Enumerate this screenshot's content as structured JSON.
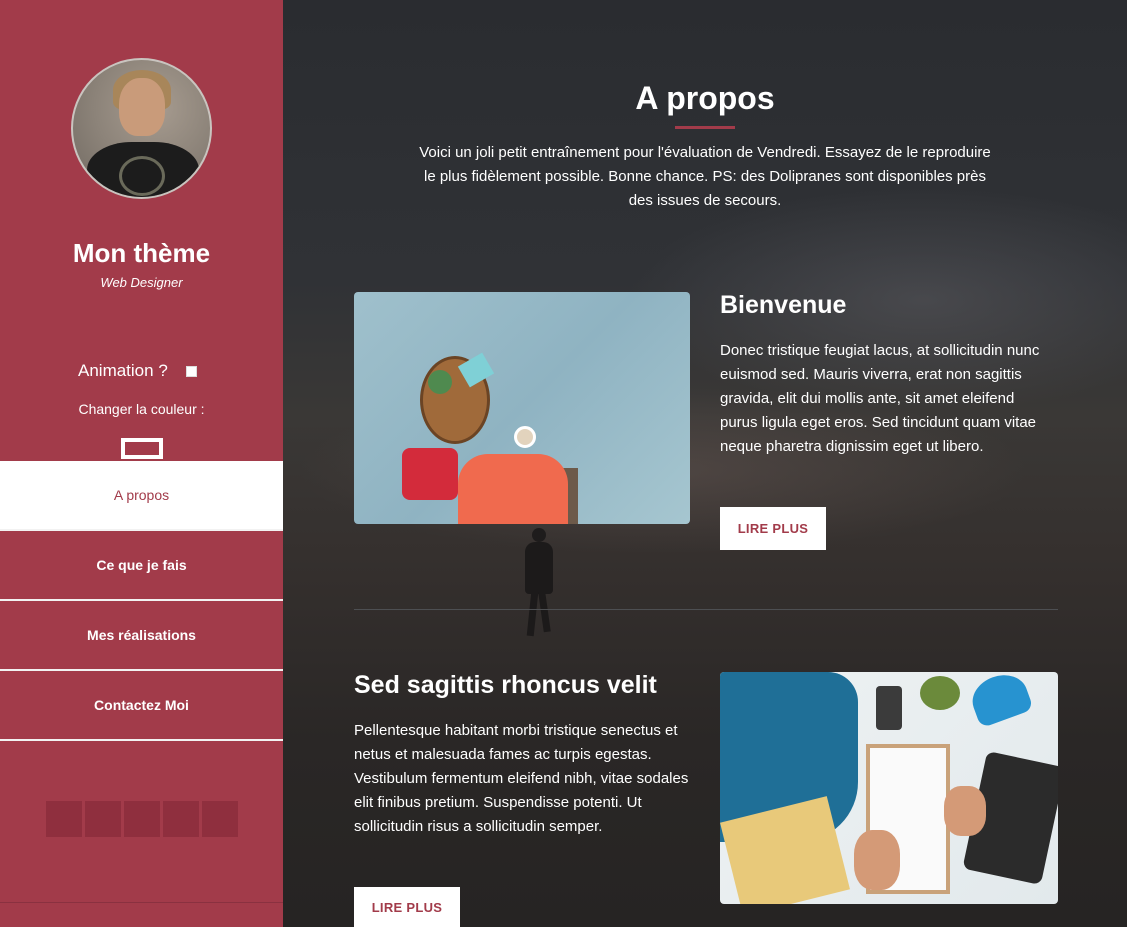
{
  "sidebar": {
    "title": "Mon thème",
    "subtitle": "Web Designer",
    "animation_label": "Animation ?",
    "color_label": "Changer la couleur :",
    "nav": [
      {
        "label": "A propos",
        "active": true
      },
      {
        "label": "Ce que je fais",
        "active": false
      },
      {
        "label": "Mes réalisations",
        "active": false
      },
      {
        "label": "Contactez Moi",
        "active": false
      }
    ],
    "social_icons": [
      "social-icon-1",
      "social-icon-2",
      "social-icon-3",
      "social-icon-4",
      "social-icon-5"
    ]
  },
  "main": {
    "title": "A propos",
    "intro": "Voici un joli petit entraînement pour l'évaluation de Vendredi. Essayez de le reproduire le plus fidèlement possible. Bonne chance. PS: des Dolipranes sont disponibles près des issues de secours.",
    "block1": {
      "heading": "Bienvenue",
      "text": "Donec tristique feugiat lacus, at sollicitudin nunc euismod sed. Mauris viverra, erat non sagittis gravida, elit dui mollis ante, sit amet eleifend purus ligula eget eros. Sed tincidunt quam vitae neque pharetra dignissim eget ut libero.",
      "button": "LIRE PLUS"
    },
    "block2": {
      "heading": "Sed sagittis rhoncus velit",
      "text": "Pellentesque habitant morbi tristique senectus et netus et malesuada fames ac turpis egestas. Vestibulum fermentum eleifend nibh, vitae sodales elit finibus pretium. Suspendisse potenti. Ut sollicitudin risus a sollicitudin semper.",
      "button": "LIRE PLUS"
    }
  },
  "colors": {
    "accent": "#a23b4a",
    "background": "#2b2b2e"
  }
}
